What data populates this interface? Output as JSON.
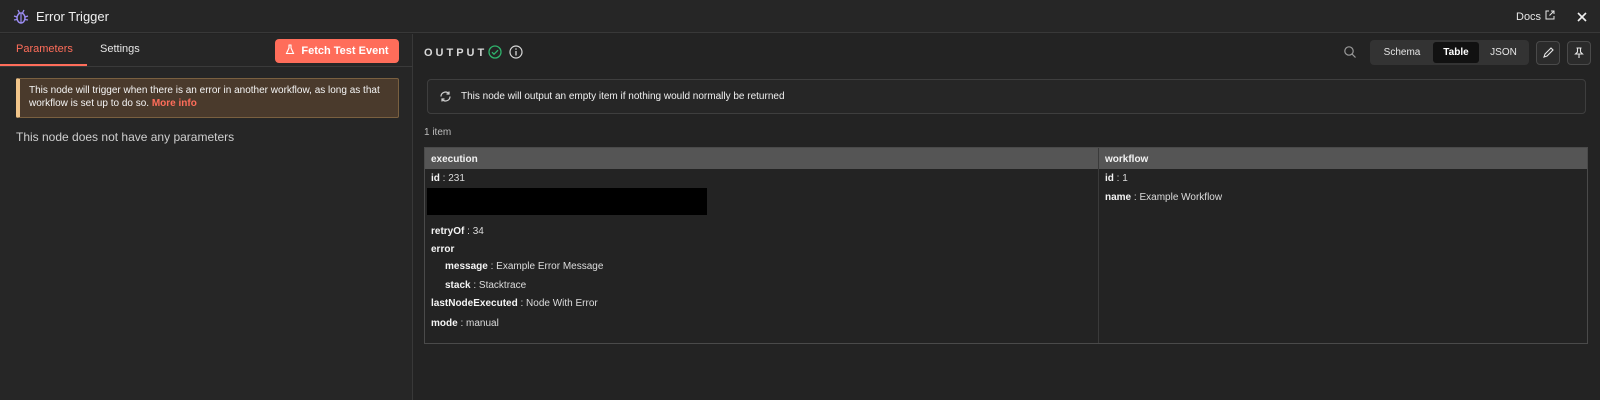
{
  "window": {
    "title": "Error Trigger",
    "docs_label": "Docs",
    "title_icon": "bug-icon",
    "close_icon": "close-icon"
  },
  "left": {
    "tabs": [
      {
        "label": "Parameters",
        "active": true
      },
      {
        "label": "Settings",
        "active": false
      }
    ],
    "fetch_button": "Fetch Test Event",
    "notice_text": "This node will trigger when there is an error in another workflow, as long as that workflow is set up to do so.",
    "notice_link": "More info",
    "no_params": "This node does not have any parameters"
  },
  "output": {
    "label": "OUTPUT",
    "view_options": [
      "Schema",
      "Table",
      "JSON"
    ],
    "selected_view": "Table",
    "empty_notice": "This node will output an empty item if nothing would normally be returned",
    "item_count": "1 item",
    "columns": [
      "execution",
      "workflow"
    ],
    "execution": {
      "id_key": "id",
      "id_val": "231",
      "retry_key": "retryOf",
      "retry_val": "34",
      "error_key": "error",
      "message_key": "message",
      "message_val": "Example Error Message",
      "stack_key": "stack",
      "stack_val": "Stacktrace",
      "lastnode_key": "lastNodeExecuted",
      "lastnode_val": "Node With Error",
      "mode_key": "mode",
      "mode_val": "manual"
    },
    "workflow": {
      "id_key": "id",
      "id_val": "1",
      "name_key": "name",
      "name_val": "Example Workflow"
    }
  },
  "colors": {
    "accent": "#ff6d5a",
    "success": "#2fb36c",
    "notice_border": "#f1c58a"
  }
}
